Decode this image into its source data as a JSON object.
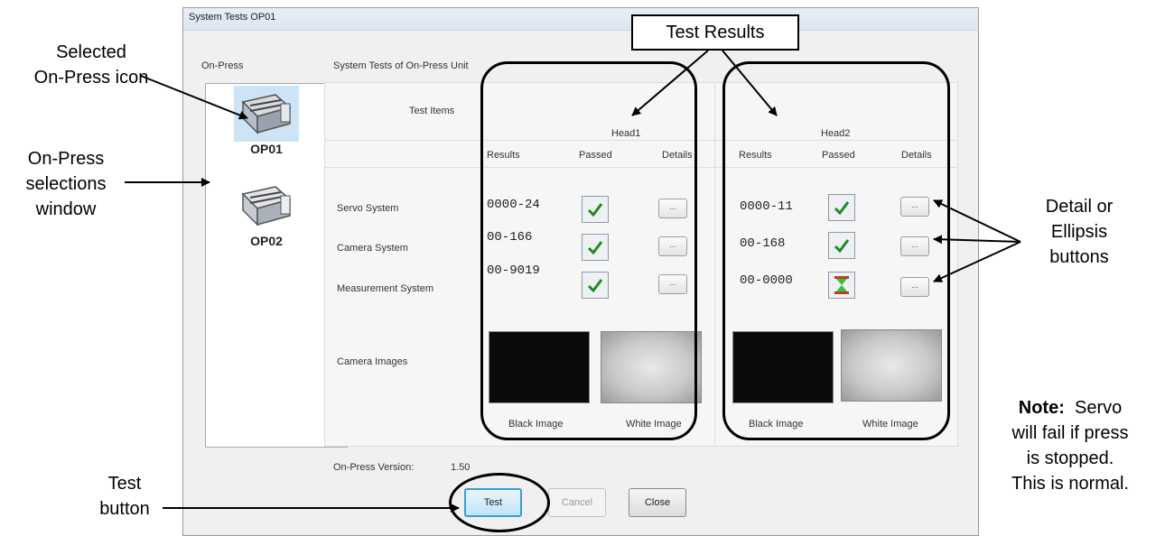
{
  "window": {
    "title": "System Tests  OP01"
  },
  "left": {
    "header": "On-Press",
    "presses": [
      {
        "label": "OP01",
        "selected": true
      },
      {
        "label": "OP02",
        "selected": false
      }
    ]
  },
  "main": {
    "header": "System Tests of On-Press Unit",
    "test_items_label": "Test Items",
    "heads": [
      {
        "name": "Head1",
        "col_results": "Results",
        "col_passed": "Passed",
        "col_details": "Details",
        "results": [
          "0000-24",
          "00-166",
          "00-9019"
        ],
        "status": [
          "passed",
          "passed",
          "pending"
        ],
        "details_label": "...",
        "black_image_label": "Black Image",
        "white_image_label": "White Image"
      },
      {
        "name": "Head2",
        "col_results": "Results",
        "col_passed": "Passed",
        "col_details": "Details",
        "results": [
          "0000-11",
          "00-168",
          "00-0000"
        ],
        "status": [
          "passed",
          "passed",
          "pending"
        ],
        "details_label": "...",
        "black_image_label": "Black Image",
        "white_image_label": "White Image"
      }
    ],
    "rows": [
      "Servo System",
      "Camera System",
      "Measurement System"
    ],
    "camera_images_label": "Camera Images"
  },
  "version": {
    "label": "On-Press Version:",
    "value": "1.50"
  },
  "buttons": {
    "test": "Test",
    "cancel": "Cancel",
    "close": "Close"
  },
  "annotations": {
    "test_results": "Test Results",
    "selected_icon": [
      "Selected",
      "On-Press icon"
    ],
    "selections_window": [
      "On-Press",
      "selections",
      "window"
    ],
    "detail_buttons": [
      "Detail or",
      "Ellipsis",
      "buttons"
    ],
    "test_button": [
      "Test",
      "button"
    ],
    "note_bold": "Note:",
    "note_lines": [
      "Servo",
      "will fail if press",
      "is stopped.",
      "This is normal."
    ]
  },
  "colors": {
    "check_green": "#1f8a22",
    "hourglass_red": "#c23b2a",
    "hourglass_green": "#3cbf3c",
    "default_button_border": "#3d9bd6"
  }
}
